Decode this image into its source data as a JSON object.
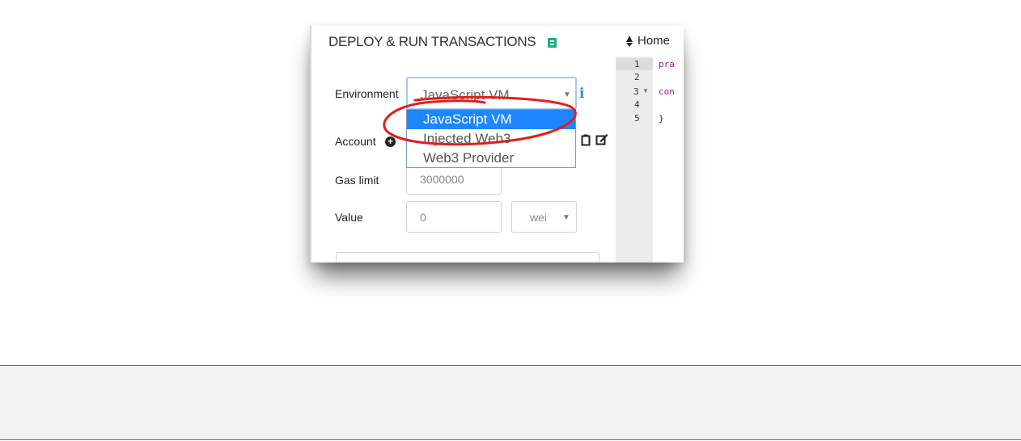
{
  "panel": {
    "title": "DEPLOY & RUN TRANSACTIONS",
    "environment_label": "Environment",
    "environment_value": "JavaScript VM",
    "environment_options": [
      "JavaScript VM",
      "Injected Web3",
      "Web3 Provider"
    ],
    "account_label": "Account",
    "gas_limit_label": "Gas limit",
    "gas_limit_value": "3000000",
    "value_label": "Value",
    "value_value": "0",
    "unit_value": "wei"
  },
  "editor": {
    "tab_label": "Home",
    "line_numbers": [
      "1",
      "2",
      "3",
      "4",
      "5"
    ],
    "code_lines": [
      "pra",
      "",
      "con",
      "",
      "}"
    ]
  },
  "colors": {
    "selection": "#1e86ff",
    "annotation": "#e0201b",
    "accent": "#1aaf7c",
    "info": "#2f8fd8"
  },
  "icons": [
    "book-icon",
    "info-icon",
    "plus-circle-icon",
    "clipboard-icon",
    "edit-icon",
    "ethereum-icon",
    "fold-arrow-icon"
  ]
}
